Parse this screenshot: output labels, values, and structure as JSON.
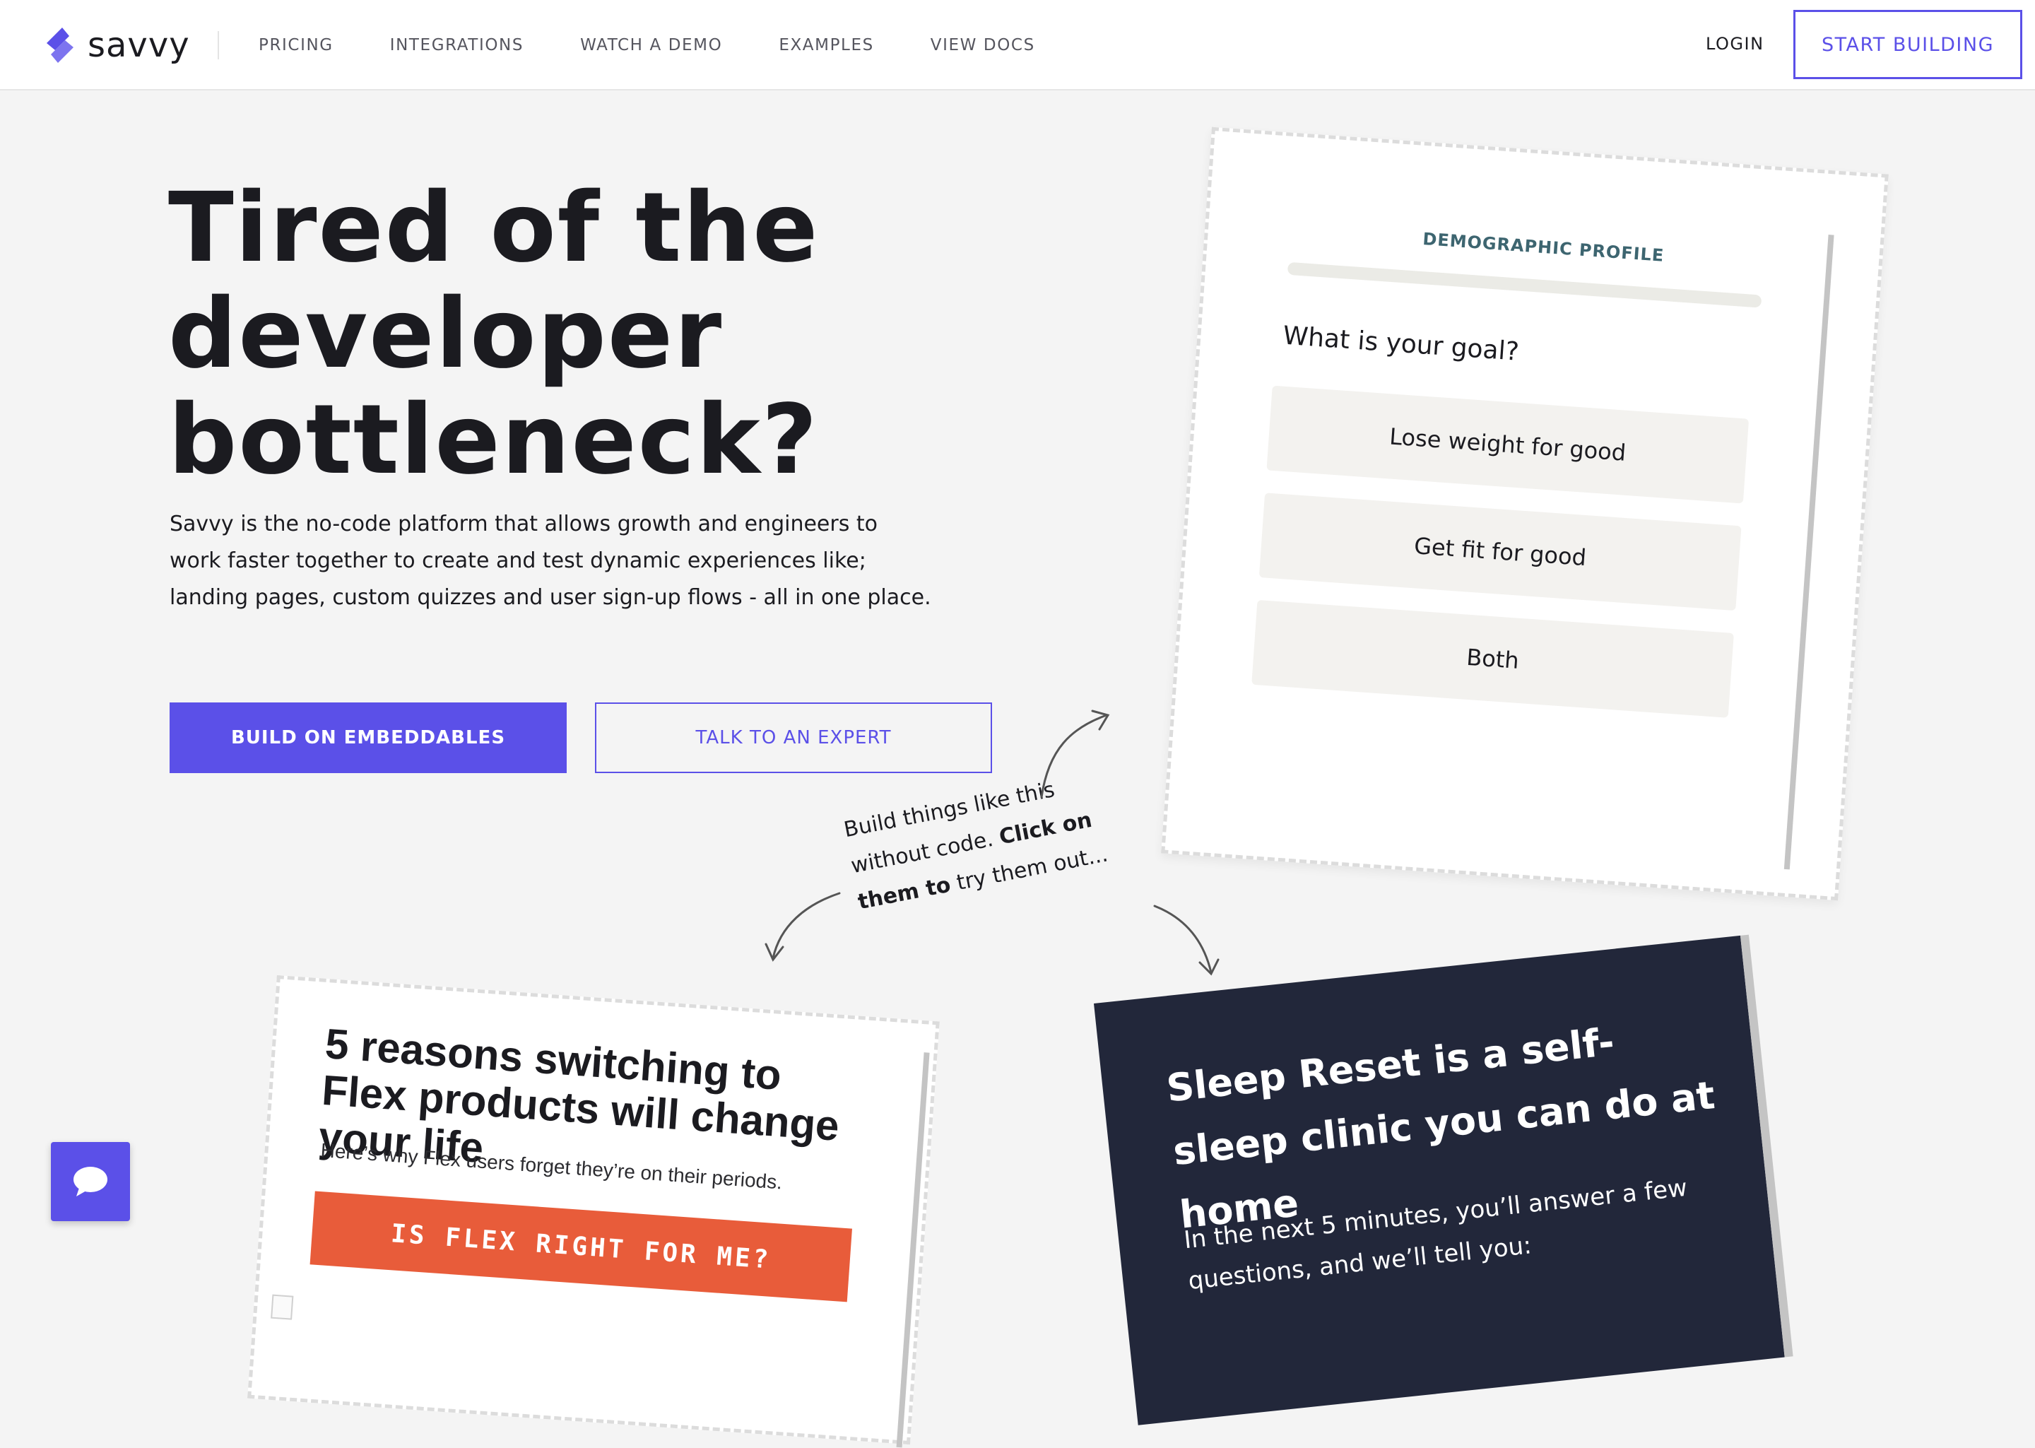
{
  "nav": {
    "brand": "savvy",
    "links": [
      "PRICING",
      "INTEGRATIONS",
      "WATCH A DEMO",
      "EXAMPLES",
      "VIEW DOCS"
    ],
    "login": "LOGIN",
    "cta": "START BUILDING"
  },
  "hero": {
    "title_lines": [
      "Tired of the",
      "developer",
      "bottleneck?"
    ],
    "description": "Savvy is the no-code platform that allows growth and engineers to work faster together to create and test dynamic experiences like; landing pages, custom quizzes and user sign-up flows - all in one place.",
    "primary_button": "BUILD ON EMBEDDABLES",
    "secondary_button": "TALK TO AN EXPERT"
  },
  "hint": {
    "line1": "Build things like this",
    "line2_plain": "without code. ",
    "line2_bold": "Click on",
    "line3_bold": "them to",
    "line3_plain": " try them out..."
  },
  "demographic_card": {
    "header": "DEMOGRAPHIC PROFILE",
    "question": "What is your goal?",
    "options": [
      "Lose weight for good",
      "Get fit for good",
      "Both"
    ]
  },
  "flex_card": {
    "title": "5 reasons switching to Flex products will change your life",
    "subtitle": "Here’s why Flex users forget they’re on their periods.",
    "button": "IS FLEX RIGHT FOR ME?"
  },
  "sleep_card": {
    "title": "Sleep Reset is a self-sleep clinic you can do at home",
    "subtitle": "In the next 5 minutes, you’ll answer a few questions, and we’ll tell you:"
  },
  "colors": {
    "accent": "#5b50e8",
    "flex_button": "#e85c3a",
    "sleep_bg": "#22273a",
    "demo_header": "#3d6570"
  },
  "icons": {
    "logo": "savvy-chevron-logo",
    "chat": "chat-bubble-icon"
  }
}
